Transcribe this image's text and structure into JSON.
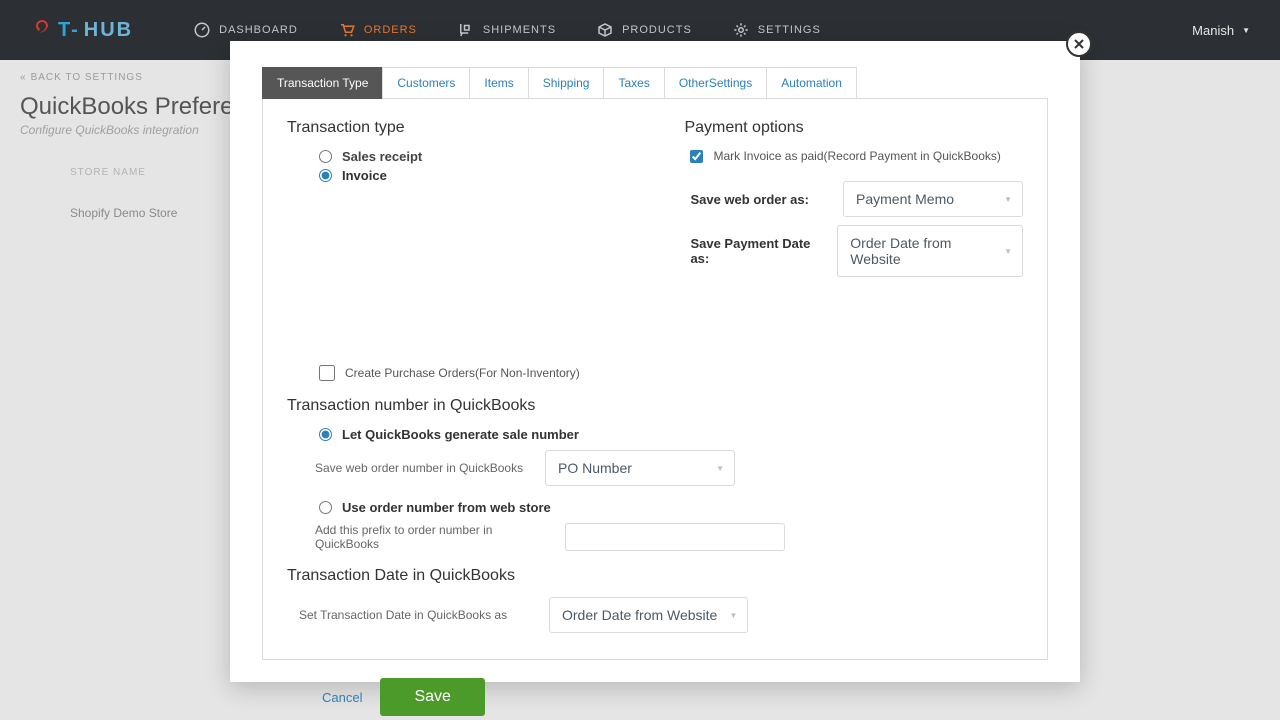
{
  "logo": {
    "text1": "T-",
    "text2": "HUB"
  },
  "nav": {
    "dashboard": "DASHBOARD",
    "orders": "ORDERS",
    "shipments": "SHIPMENTS",
    "products": "PRODUCTS",
    "settings": "SETTINGS"
  },
  "user": {
    "name": "Manish"
  },
  "page": {
    "back": "BACK TO SETTINGS",
    "title": "QuickBooks Preference",
    "sub": "Configure QuickBooks integration",
    "store_label": "STORE NAME",
    "store_value": "Shopify Demo Store"
  },
  "tabs": {
    "transaction_type": "Transaction Type",
    "customers": "Customers",
    "items": "Items",
    "shipping": "Shipping",
    "taxes": "Taxes",
    "other_settings": "OtherSettings",
    "automation": "Automation"
  },
  "form": {
    "tx_type_heading": "Transaction type",
    "sales_receipt": "Sales receipt",
    "invoice": "Invoice",
    "payment_heading": "Payment options",
    "mark_invoice": "Mark Invoice as paid(Record Payment in QuickBooks)",
    "save_web_order_as": "Save web order as:",
    "save_web_order_as_value": "Payment Memo",
    "save_payment_date_as": "Save Payment Date as:",
    "save_payment_date_as_value": "Order Date from Website",
    "create_po": "Create Purchase Orders(For Non-Inventory)",
    "tx_number_heading": "Transaction number in QuickBooks",
    "let_qb_generate": "Let QuickBooks generate sale number",
    "save_web_order_number": "Save web order number in QuickBooks",
    "save_web_order_number_value": "PO Number",
    "use_order_number": "Use order number from web store",
    "add_prefix": "Add this prefix to order number in QuickBooks",
    "tx_date_heading": "Transaction Date in QuickBooks",
    "set_tx_date": "Set Transaction Date in QuickBooks as",
    "set_tx_date_value": "Order Date from Website"
  },
  "buttons": {
    "cancel": "Cancel",
    "save": "Save"
  }
}
